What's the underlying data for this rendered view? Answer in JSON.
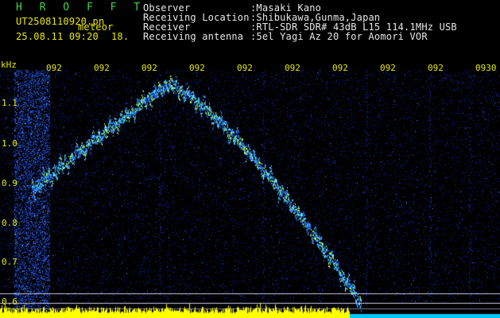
{
  "header": {
    "brand": "H R O F F T",
    "filename": "UT2508110920.pn",
    "tag": "meteor",
    "datetime": "25.08.11 09:20",
    "number": "18.",
    "info": [
      {
        "label": "Observer",
        "value": ":Masaki Kano"
      },
      {
        "label": "Receiving Location",
        "value": ":Shibukawa,Gunma,Japan"
      },
      {
        "label": "Receiver",
        "value": ":RTL-SDR SDR# 43dB L15 114.1MHz USB"
      },
      {
        "label": "Receiving antenna",
        "value": ":5el Yagi Az 20 for Aomori VOR"
      }
    ]
  },
  "plot": {
    "unit": "kHz",
    "y_ticks": [
      "1.1",
      "1.0",
      "0.9",
      "0.8",
      "0.7",
      "0.6"
    ],
    "time_ticks": [
      "092",
      "092",
      "092",
      "092",
      "092",
      "092",
      "092",
      "092",
      "092",
      "0930"
    ],
    "colors": {
      "background": "#000000",
      "noise": "#1428b4",
      "signal": "#3cc8ff",
      "peak": "#b4ff50",
      "bars": "#ffff00",
      "text": "#e6e600"
    }
  }
}
